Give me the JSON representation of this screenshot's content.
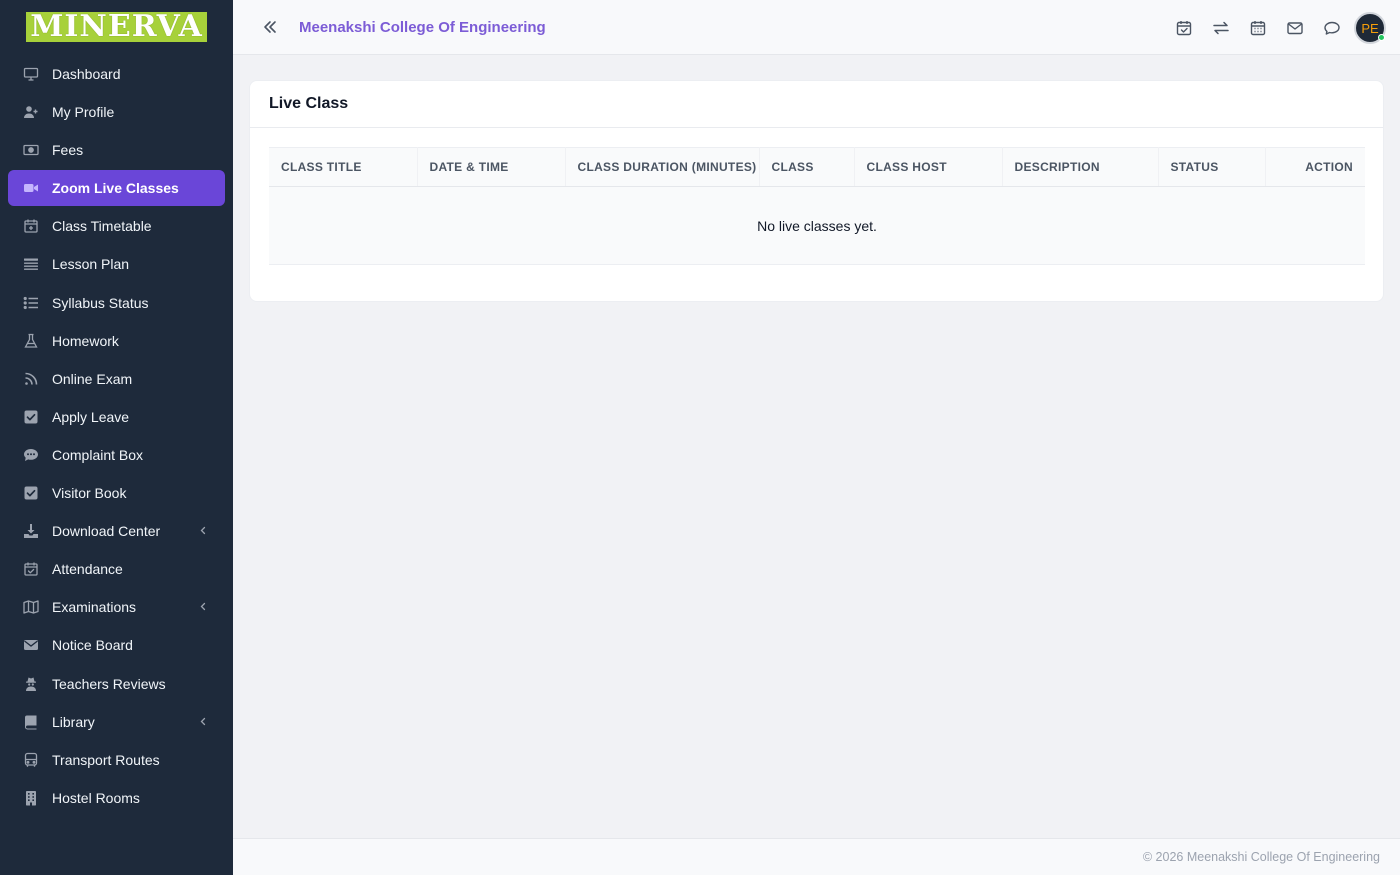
{
  "brand": {
    "logo_text": "MINERVA",
    "accent_color": "#6a46d8",
    "logo_bg": "#a7d13a"
  },
  "sidebar": {
    "items": [
      {
        "label": "Dashboard",
        "icon": "monitor-icon"
      },
      {
        "label": "My Profile",
        "icon": "user-plus-icon"
      },
      {
        "label": "Fees",
        "icon": "money-bill-icon"
      },
      {
        "label": "Zoom Live Classes",
        "icon": "video-icon",
        "active": true
      },
      {
        "label": "Class Timetable",
        "icon": "calendar-plus-icon"
      },
      {
        "label": "Lesson Plan",
        "icon": "list-lines-icon"
      },
      {
        "label": "Syllabus Status",
        "icon": "list-check-icon"
      },
      {
        "label": "Homework",
        "icon": "flask-icon"
      },
      {
        "label": "Online Exam",
        "icon": "rss-icon"
      },
      {
        "label": "Apply Leave",
        "icon": "check-square-icon"
      },
      {
        "label": "Complaint Box",
        "icon": "comment-dots-icon"
      },
      {
        "label": "Visitor Book",
        "icon": "check-square-icon"
      },
      {
        "label": "Download Center",
        "icon": "download-icon",
        "expandable": true
      },
      {
        "label": "Attendance",
        "icon": "calendar-check-icon"
      },
      {
        "label": "Examinations",
        "icon": "map-icon",
        "expandable": true
      },
      {
        "label": "Notice Board",
        "icon": "envelope-icon"
      },
      {
        "label": "Teachers Reviews",
        "icon": "user-secret-icon"
      },
      {
        "label": "Library",
        "icon": "book-icon",
        "expandable": true
      },
      {
        "label": "Transport Routes",
        "icon": "bus-icon"
      },
      {
        "label": "Hostel Rooms",
        "icon": "building-icon"
      }
    ]
  },
  "header": {
    "title": "Meenakshi College Of Engineering",
    "icons": [
      "calendar-check-icon",
      "exchange-icon",
      "calendar-icon",
      "envelope-icon",
      "chat-icon"
    ],
    "avatar_initials": "PE"
  },
  "main": {
    "card_title": "Live Class",
    "table": {
      "columns": [
        "CLASS TITLE",
        "DATE & TIME",
        "CLASS DURATION (MINUTES)",
        "CLASS",
        "CLASS HOST",
        "DESCRIPTION",
        "STATUS",
        "ACTION"
      ],
      "empty_message": "No live classes yet."
    }
  },
  "footer": {
    "text": "© 2026 Meenakshi College Of Engineering"
  }
}
